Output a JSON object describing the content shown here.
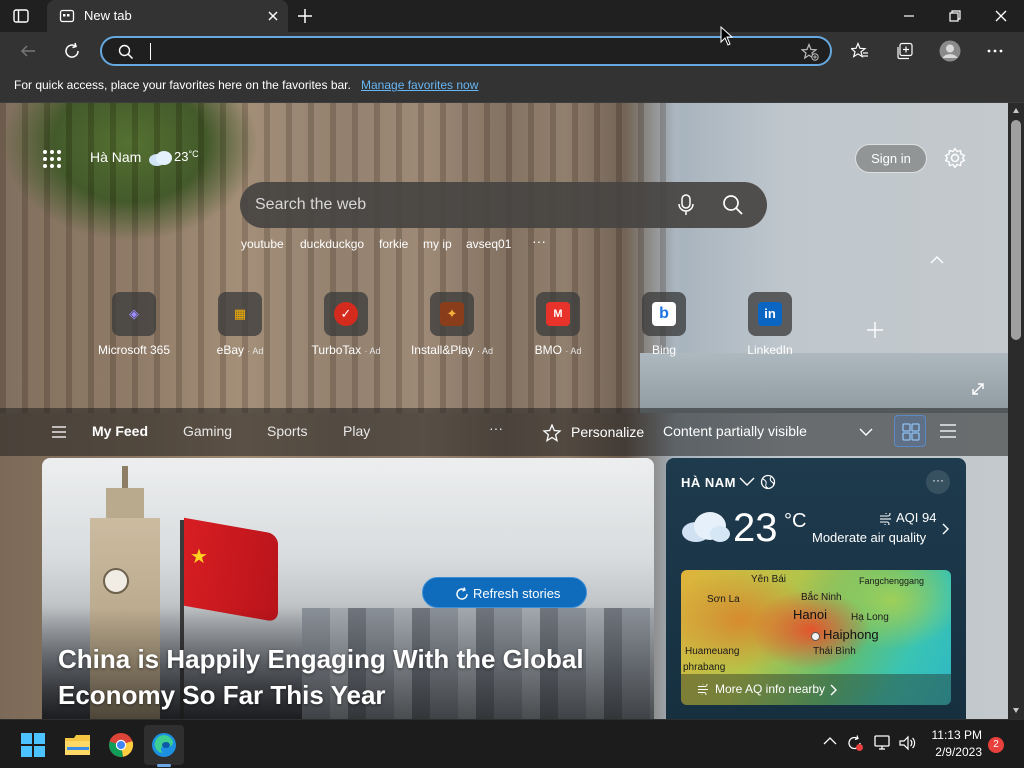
{
  "browser": {
    "tab_title": "New tab",
    "address_value": "",
    "favorites_bar_text": "For quick access, place your favorites here on the favorites bar.",
    "favorites_bar_link": "Manage favorites now"
  },
  "newtab": {
    "location": "Hà Nam",
    "temperature": "23",
    "temperature_unit": "°C",
    "sign_in_label": "Sign in",
    "search_placeholder": "Search the web",
    "suggestions": [
      "youtube",
      "duckduckgo",
      "forkie",
      "my ip",
      "avseq01"
    ],
    "suggestions_more": "···",
    "quick_links": [
      {
        "label": "Microsoft 365",
        "ad": "",
        "glyph": "◈",
        "color": "#6b5bd6"
      },
      {
        "label": "eBay",
        "ad": "· Ad",
        "glyph": "▦",
        "color": "#2f2f2f"
      },
      {
        "label": "TurboTax",
        "ad": "· Ad",
        "glyph": "✓",
        "color": "#d52b1e"
      },
      {
        "label": "Install&Play",
        "ad": "· Ad",
        "glyph": "✦",
        "color": "#8a3d1a"
      },
      {
        "label": "BMO",
        "ad": "· Ad",
        "glyph": "M",
        "color": "#0079c1"
      },
      {
        "label": "Bing",
        "ad": "",
        "glyph": "b",
        "color": "#ffffff"
      },
      {
        "label": "LinkedIn",
        "ad": "",
        "glyph": "in",
        "color": "#0a66c2"
      }
    ]
  },
  "feed_nav": {
    "items": [
      "My Feed",
      "Gaming",
      "Sports",
      "Play"
    ],
    "active": "My Feed",
    "more": "···",
    "personalize_label": "Personalize",
    "content_setting": "Content partially visible"
  },
  "hero_story": {
    "headline": "China is Happily Engaging With the Global Economy So Far This Year",
    "refresh_label": "Refresh stories"
  },
  "weather_card": {
    "city": "HÀ NAM",
    "temperature": "23",
    "unit": "°C",
    "aqi": "AQI 94",
    "aqi_description": "Moderate air quality",
    "more": "···",
    "map_labels": [
      {
        "text": "Yên Bái"
      },
      {
        "text": "Fangchenggang"
      },
      {
        "text": "Sơn La"
      },
      {
        "text": "Bắc Ninh"
      },
      {
        "text": "Hanoi"
      },
      {
        "text": "Hạ Long"
      },
      {
        "text": "Haiphong"
      },
      {
        "text": "Huameuang"
      },
      {
        "text": "Thái Bình"
      },
      {
        "text": "phrabang"
      }
    ],
    "map_footer": "More AQ info nearby"
  },
  "taskbar": {
    "time": "11:13 PM",
    "date": "2/9/2023",
    "notification_count": "2"
  }
}
